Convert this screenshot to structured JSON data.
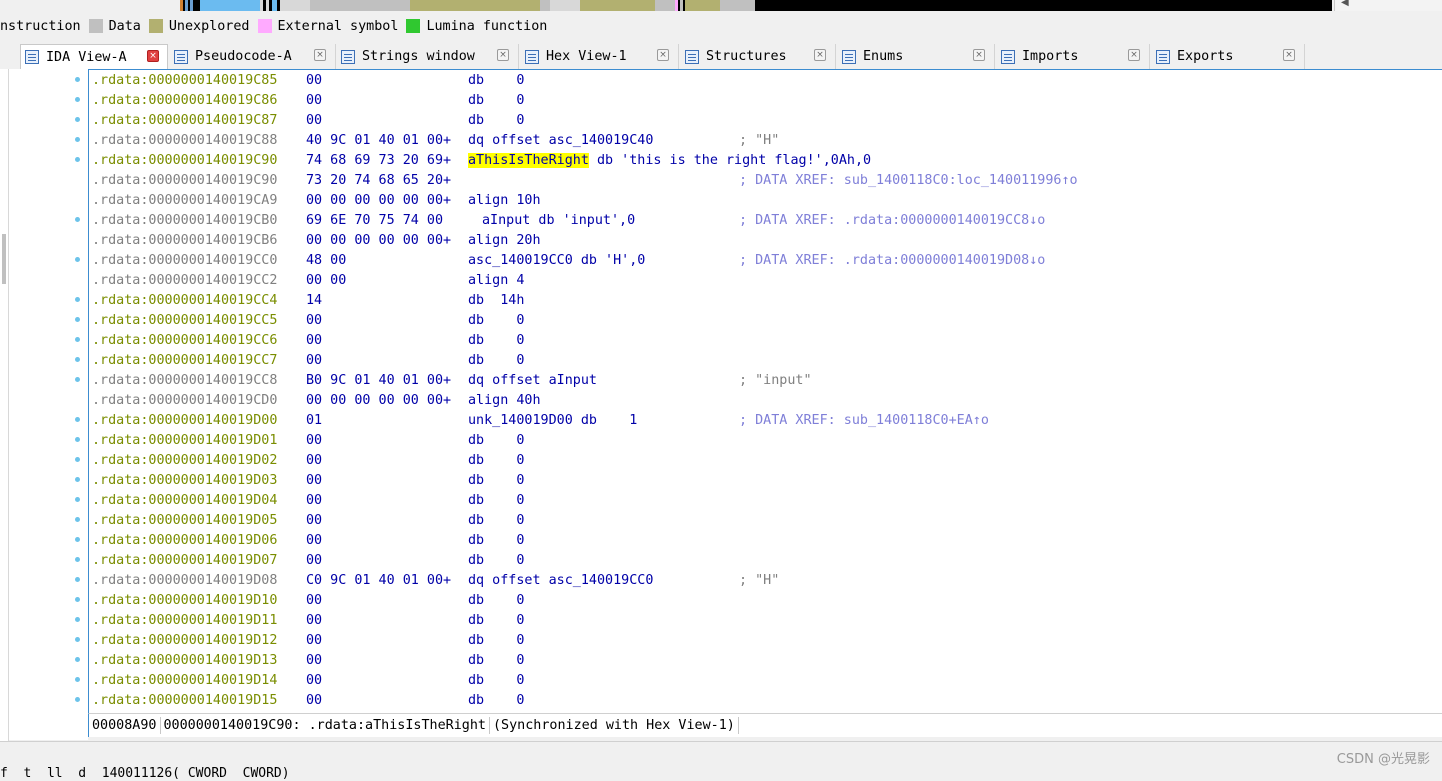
{
  "legend": [
    {
      "label": "nstruction",
      "color": null
    },
    {
      "label": "Data",
      "color": "#c0c0c0"
    },
    {
      "label": "Unexplored",
      "color": "#b2b070"
    },
    {
      "label": "External symbol",
      "color": "#ffaaff"
    },
    {
      "label": "Lumina function",
      "color": "#30c830"
    }
  ],
  "tabs": [
    {
      "label": "IDA View-A",
      "icon": "disassembly-icon",
      "active": true
    },
    {
      "label": "Pseudocode-A",
      "icon": "pseudocode-icon",
      "active": false
    },
    {
      "label": "Strings window",
      "icon": "strings-icon",
      "active": false
    },
    {
      "label": "Hex View-1",
      "icon": "hex-view-icon",
      "active": false
    },
    {
      "label": "Structures",
      "icon": "structures-icon",
      "active": false
    },
    {
      "label": "Enums",
      "icon": "enums-icon",
      "active": false
    },
    {
      "label": "Imports",
      "icon": "imports-icon",
      "active": false
    },
    {
      "label": "Exports",
      "icon": "exports-icon",
      "active": false
    }
  ],
  "colors": {
    "segment_green": "#7a8d00",
    "segment_gray": "#808080",
    "bytes_blue": "#0000a8",
    "comment": "#7f7fd8",
    "number_green": "#008000",
    "highlight": "#ffff00",
    "dot": "#6cc3ea"
  },
  "listing": [
    {
      "addr": ".rdata:0000000140019C85",
      "bytes": "00",
      "instr": "db    0",
      "comment": "",
      "dot": true,
      "seg": "green"
    },
    {
      "addr": ".rdata:0000000140019C86",
      "bytes": "00",
      "instr": "db    0",
      "comment": "",
      "dot": true,
      "seg": "green"
    },
    {
      "addr": ".rdata:0000000140019C87",
      "bytes": "00",
      "instr": "db    0",
      "comment": "",
      "dot": true,
      "seg": "green"
    },
    {
      "addr": ".rdata:0000000140019C88",
      "bytes": "40 9C 01 40 01 00+",
      "instr": "dq offset asc_140019C40",
      "comment": "; \"H\"",
      "dot": true,
      "seg": "gray"
    },
    {
      "addr": ".rdata:0000000140019C90",
      "bytes": "74 68 69 73 20 69+",
      "instr": "aThisIsTheRight db 'this is the right flag!',0Ah,0",
      "comment": "",
      "dot": true,
      "seg": "green",
      "highlight": "aThisIsTheRight"
    },
    {
      "addr": ".rdata:0000000140019C90",
      "bytes": "73 20 74 68 65 20+",
      "instr": "",
      "comment": "; DATA XREF: sub_1400118C0:loc_140011996↑o",
      "dot": false,
      "seg": "gray"
    },
    {
      "addr": ".rdata:0000000140019CA9",
      "bytes": "00 00 00 00 00 00+",
      "instr": "align 10h",
      "comment": "",
      "dot": false,
      "seg": "gray"
    },
    {
      "addr": ".rdata:0000000140019CB0",
      "bytes": "69 6E 70 75 74 00",
      "instr": "aInput db 'input',0",
      "comment": "; DATA XREF: .rdata:0000000140019CC8↓o",
      "dot": true,
      "seg": "gray",
      "inline": true
    },
    {
      "addr": ".rdata:0000000140019CB6",
      "bytes": "00 00 00 00 00 00+",
      "instr": "align 20h",
      "comment": "",
      "dot": false,
      "seg": "gray"
    },
    {
      "addr": ".rdata:0000000140019CC0",
      "bytes": "48 00",
      "instr": "asc_140019CC0 db 'H',0",
      "comment": "; DATA XREF: .rdata:0000000140019D08↓o",
      "dot": true,
      "seg": "gray"
    },
    {
      "addr": ".rdata:0000000140019CC2",
      "bytes": "00 00",
      "instr": "align 4",
      "comment": "",
      "dot": false,
      "seg": "gray"
    },
    {
      "addr": ".rdata:0000000140019CC4",
      "bytes": "14",
      "instr": "db  14h",
      "comment": "",
      "dot": true,
      "seg": "green"
    },
    {
      "addr": ".rdata:0000000140019CC5",
      "bytes": "00",
      "instr": "db    0",
      "comment": "",
      "dot": true,
      "seg": "green"
    },
    {
      "addr": ".rdata:0000000140019CC6",
      "bytes": "00",
      "instr": "db    0",
      "comment": "",
      "dot": true,
      "seg": "green"
    },
    {
      "addr": ".rdata:0000000140019CC7",
      "bytes": "00",
      "instr": "db    0",
      "comment": "",
      "dot": true,
      "seg": "green"
    },
    {
      "addr": ".rdata:0000000140019CC8",
      "bytes": "B0 9C 01 40 01 00+",
      "instr": "dq offset aInput",
      "comment": "; \"input\"",
      "dot": true,
      "seg": "gray"
    },
    {
      "addr": ".rdata:0000000140019CD0",
      "bytes": "00 00 00 00 00 00+",
      "instr": "align 40h",
      "comment": "",
      "dot": false,
      "seg": "gray"
    },
    {
      "addr": ".rdata:0000000140019D00",
      "bytes": "01",
      "instr": "unk_140019D00 db    1",
      "comment": "; DATA XREF: sub_1400118C0+EA↑o",
      "dot": true,
      "seg": "green"
    },
    {
      "addr": ".rdata:0000000140019D01",
      "bytes": "00",
      "instr": "db    0",
      "comment": "",
      "dot": true,
      "seg": "green"
    },
    {
      "addr": ".rdata:0000000140019D02",
      "bytes": "00",
      "instr": "db    0",
      "comment": "",
      "dot": true,
      "seg": "green"
    },
    {
      "addr": ".rdata:0000000140019D03",
      "bytes": "00",
      "instr": "db    0",
      "comment": "",
      "dot": true,
      "seg": "green"
    },
    {
      "addr": ".rdata:0000000140019D04",
      "bytes": "00",
      "instr": "db    0",
      "comment": "",
      "dot": true,
      "seg": "green"
    },
    {
      "addr": ".rdata:0000000140019D05",
      "bytes": "00",
      "instr": "db    0",
      "comment": "",
      "dot": true,
      "seg": "green"
    },
    {
      "addr": ".rdata:0000000140019D06",
      "bytes": "00",
      "instr": "db    0",
      "comment": "",
      "dot": true,
      "seg": "green"
    },
    {
      "addr": ".rdata:0000000140019D07",
      "bytes": "00",
      "instr": "db    0",
      "comment": "",
      "dot": true,
      "seg": "green"
    },
    {
      "addr": ".rdata:0000000140019D08",
      "bytes": "C0 9C 01 40 01 00+",
      "instr": "dq offset asc_140019CC0",
      "comment": "; \"H\"",
      "dot": true,
      "seg": "gray"
    },
    {
      "addr": ".rdata:0000000140019D10",
      "bytes": "00",
      "instr": "db    0",
      "comment": "",
      "dot": true,
      "seg": "green"
    },
    {
      "addr": ".rdata:0000000140019D11",
      "bytes": "00",
      "instr": "db    0",
      "comment": "",
      "dot": true,
      "seg": "green"
    },
    {
      "addr": ".rdata:0000000140019D12",
      "bytes": "00",
      "instr": "db    0",
      "comment": "",
      "dot": true,
      "seg": "green"
    },
    {
      "addr": ".rdata:0000000140019D13",
      "bytes": "00",
      "instr": "db    0",
      "comment": "",
      "dot": true,
      "seg": "green"
    },
    {
      "addr": ".rdata:0000000140019D14",
      "bytes": "00",
      "instr": "db    0",
      "comment": "",
      "dot": true,
      "seg": "green"
    },
    {
      "addr": ".rdata:0000000140019D15",
      "bytes": "00",
      "instr": "db    0",
      "comment": "",
      "dot": true,
      "seg": "green"
    }
  ],
  "status": {
    "offset": "00008A90",
    "location": "0000000140019C90: .rdata:aThisIsTheRight",
    "sync": "(Synchronized with Hex View-1)"
  },
  "bottom_peek": "f  t  ll  d  140011126( CWORD  CWORD)",
  "watermark": "CSDN @光晃影"
}
